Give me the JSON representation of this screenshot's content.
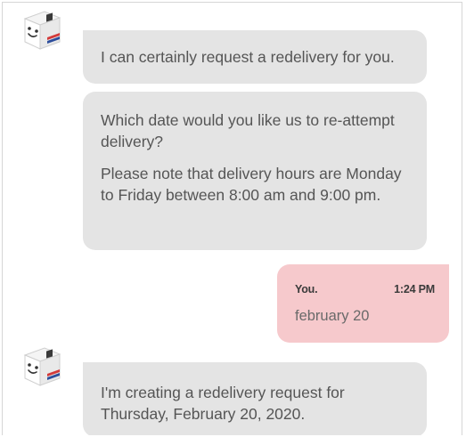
{
  "conversation": {
    "bot_avatar_icon": "smiling-box-mascot-icon",
    "messages": [
      {
        "text": "I can certainly request a redelivery for you."
      },
      {
        "paragraphs": [
          "Which date would you like us to re-attempt delivery?",
          "Please note that delivery hours are Monday to Friday between 8:00 am and 9:00 pm."
        ]
      },
      {
        "sender": "You.",
        "time": "1:24 PM",
        "text": "february 20"
      },
      {
        "text": "I'm creating a redelivery request for Thursday, February 20, 2020."
      }
    ]
  },
  "colors": {
    "bot_bubble": "#e4e4e4",
    "user_bubble": "#f6c9cc"
  }
}
